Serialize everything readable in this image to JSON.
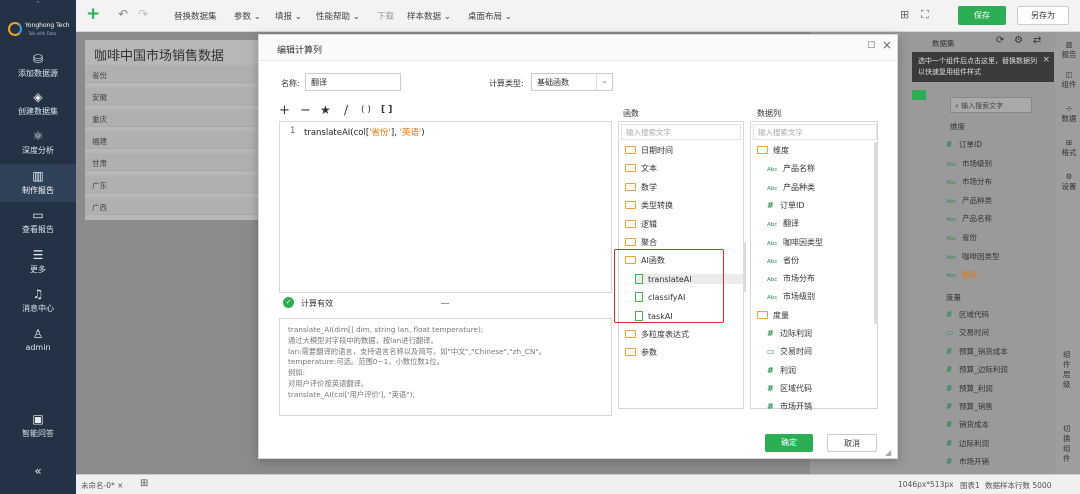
{
  "brand": {
    "name": "Yonghong Tech",
    "tagline": "Talk with Data"
  },
  "sidebar": {
    "items": [
      {
        "label": "添加数据源",
        "icon": "database-icon"
      },
      {
        "label": "创建数据集",
        "icon": "layers-icon"
      },
      {
        "label": "深度分析",
        "icon": "network-icon"
      },
      {
        "label": "制作报告",
        "icon": "bar-chart-icon"
      },
      {
        "label": "查看报告",
        "icon": "monitor-chart-icon"
      },
      {
        "label": "更多",
        "icon": "menu-icon"
      },
      {
        "label": "消息中心",
        "icon": "bell-icon"
      },
      {
        "label": "admin",
        "icon": "user-icon"
      },
      {
        "label": "智能问答",
        "icon": "chat-icon"
      }
    ],
    "collapse": "«"
  },
  "toolbar": {
    "add": "+",
    "undo": "↶",
    "redo": "↷",
    "items": [
      "替换数据集",
      "参数",
      "填报",
      "性能帮助",
      "下载",
      "样本数据",
      "桌面布局"
    ],
    "save": "保存",
    "save_as": "另存为"
  },
  "report": {
    "title": "咖啡中国市场销售数据",
    "rows": [
      "省份",
      "安徽",
      "重庆",
      "福建",
      "甘肃",
      "广东",
      "广西"
    ]
  },
  "right_panel": {
    "dataset_label": "数据集",
    "tip": "选中一个组件后点击这里，替换数据列以快速复用组件样式",
    "search_placeholder": "输入搜索文字",
    "dimension_header": "维度",
    "measure_header": "度量",
    "fields": [
      {
        "icon": "#",
        "label": "订单ID"
      },
      {
        "icon": "Abc",
        "label": "市场级别"
      },
      {
        "icon": "Abc",
        "label": "市场分布"
      },
      {
        "icon": "Abc",
        "label": "产品种类"
      },
      {
        "icon": "Abc",
        "label": "产品名称"
      },
      {
        "icon": "Abc",
        "label": "省份"
      },
      {
        "icon": "Abc",
        "label": "咖啡因类型"
      },
      {
        "icon": "Abc",
        "label": "翻译"
      }
    ],
    "measures": [
      {
        "icon": "#",
        "label": "区域代码"
      },
      {
        "icon": "cal",
        "label": "交易时间"
      },
      {
        "icon": "#",
        "label": "预算_销货成本"
      },
      {
        "icon": "#",
        "label": "预算_边际利润"
      },
      {
        "icon": "#",
        "label": "预算_利润"
      },
      {
        "icon": "#",
        "label": "预算_销售"
      },
      {
        "icon": "#",
        "label": "销货成本"
      },
      {
        "icon": "#",
        "label": "边际利润"
      },
      {
        "icon": "#",
        "label": "市场开销"
      }
    ],
    "tabs": [
      "报告",
      "组件",
      "数据",
      "格式",
      "设置"
    ],
    "side_vertical": "组件层级",
    "side_vertical2": "切换组件"
  },
  "status": {
    "tab": "未命名-0*",
    "size": "1046px*513px",
    "page": "图表1",
    "rows": "数据样本行数 5000"
  },
  "dialog": {
    "title": "编辑计算列",
    "name_label": "名称:",
    "name_value": "翻译",
    "type_label": "计算类型:",
    "type_value": "基础函数",
    "ops": [
      "+",
      "−",
      "★",
      "/",
      "( )",
      "[ ]"
    ],
    "line_no": "1",
    "code_prefix": "translateAI(col[",
    "code_arg1": "'省份'",
    "code_mid": "], ",
    "code_arg2": "'英语'",
    "code_suffix": ")",
    "valid": "计算有效",
    "help": [
      "translate_AI(dim[] dim, string lan, float temperature);",
      "通过大模型对字段中的数据，按lan进行翻译。",
      "lan:需要翻译的语言，支持语言名称以及简写，如\"中文\",\"Chinese\",\"zh_CN\"。",
      "temperature:可选。范围0~1，小数位数1位。",
      "例如:",
      "对用户评价按英语翻译。",
      "translate_AI(col['用户评价'], \"英语\");"
    ],
    "func_header": "函数",
    "func_search": "输入搜索文字",
    "funcs": [
      "日期时间",
      "文本",
      "数学",
      "类型转换",
      "逻辑",
      "聚合",
      "AI函数"
    ],
    "ai_funcs": [
      "translateAI",
      "classifyAI",
      "taskAI"
    ],
    "funcs_after": [
      "多粒度表达式",
      "参数"
    ],
    "col_header": "数据列",
    "col_search": "输入搜索文字",
    "cols_dim_header": "维度",
    "cols_dim": [
      {
        "icon": "Abc",
        "label": "产品名称"
      },
      {
        "icon": "Abc",
        "label": "产品种类"
      },
      {
        "icon": "#",
        "label": "订单ID"
      },
      {
        "icon": "Abc",
        "label": "翻译"
      },
      {
        "icon": "Abc",
        "label": "咖啡因类型"
      },
      {
        "icon": "Abc",
        "label": "省份"
      },
      {
        "icon": "Abc",
        "label": "市场分布"
      },
      {
        "icon": "Abc",
        "label": "市场级别"
      }
    ],
    "cols_measure_header": "度量",
    "cols_measure": [
      {
        "icon": "#",
        "label": "边际利润"
      },
      {
        "icon": "cal",
        "label": "交易时间"
      },
      {
        "icon": "#",
        "label": "利润"
      },
      {
        "icon": "#",
        "label": "区域代码"
      },
      {
        "icon": "#",
        "label": "市场开销"
      }
    ],
    "ok": "确定",
    "cancel": "取消"
  },
  "colors": {
    "sidebar": "#233245",
    "accent": "#2bae54",
    "highlight": "#e02a2a",
    "folder": "#e8a238"
  }
}
